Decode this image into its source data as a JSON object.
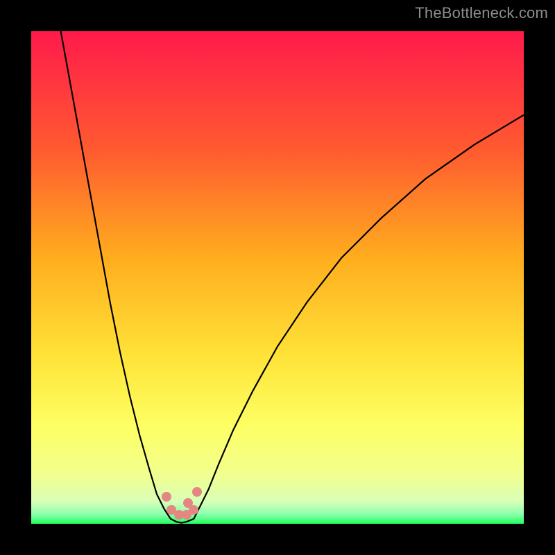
{
  "watermark": "TheBottleneck.com",
  "chart_data": {
    "type": "line",
    "title": "",
    "xlabel": "",
    "ylabel": "",
    "xlim": [
      0,
      100
    ],
    "ylim": [
      0,
      100
    ],
    "grid": false,
    "legend": false,
    "background_gradient": [
      "#ff1a4b",
      "#ff6b2d",
      "#ffc51e",
      "#fffb57",
      "#f7ff88",
      "#2dff66"
    ],
    "series": [
      {
        "name": "bottleneck-curve-left",
        "x": [
          6,
          8,
          10,
          12,
          14,
          16,
          18,
          20,
          22,
          24,
          25.5,
          27,
          28.3
        ],
        "values": [
          100,
          89,
          78,
          67,
          56,
          45,
          35,
          26,
          18,
          11,
          6,
          3,
          1
        ]
      },
      {
        "name": "bottleneck-curve-right",
        "x": [
          33,
          34,
          36,
          38,
          41,
          45,
          50,
          56,
          63,
          71,
          80,
          90,
          100
        ],
        "values": [
          1,
          3,
          7,
          12,
          19,
          27,
          36,
          45,
          54,
          62,
          70,
          77,
          83
        ]
      },
      {
        "name": "flat-bottom",
        "x": [
          28.3,
          29.5,
          30.5,
          31.5,
          33
        ],
        "values": [
          1,
          0.4,
          0.2,
          0.4,
          1
        ]
      }
    ],
    "markers": {
      "name": "optimum-cluster",
      "color": "#e48782",
      "points": [
        {
          "x": 27.5,
          "y": 5.5
        },
        {
          "x": 28.5,
          "y": 2.8
        },
        {
          "x": 30.0,
          "y": 1.8
        },
        {
          "x": 31.5,
          "y": 1.8
        },
        {
          "x": 31.8,
          "y": 4.2
        },
        {
          "x": 33.0,
          "y": 2.8
        },
        {
          "x": 33.7,
          "y": 6.5
        }
      ]
    }
  }
}
